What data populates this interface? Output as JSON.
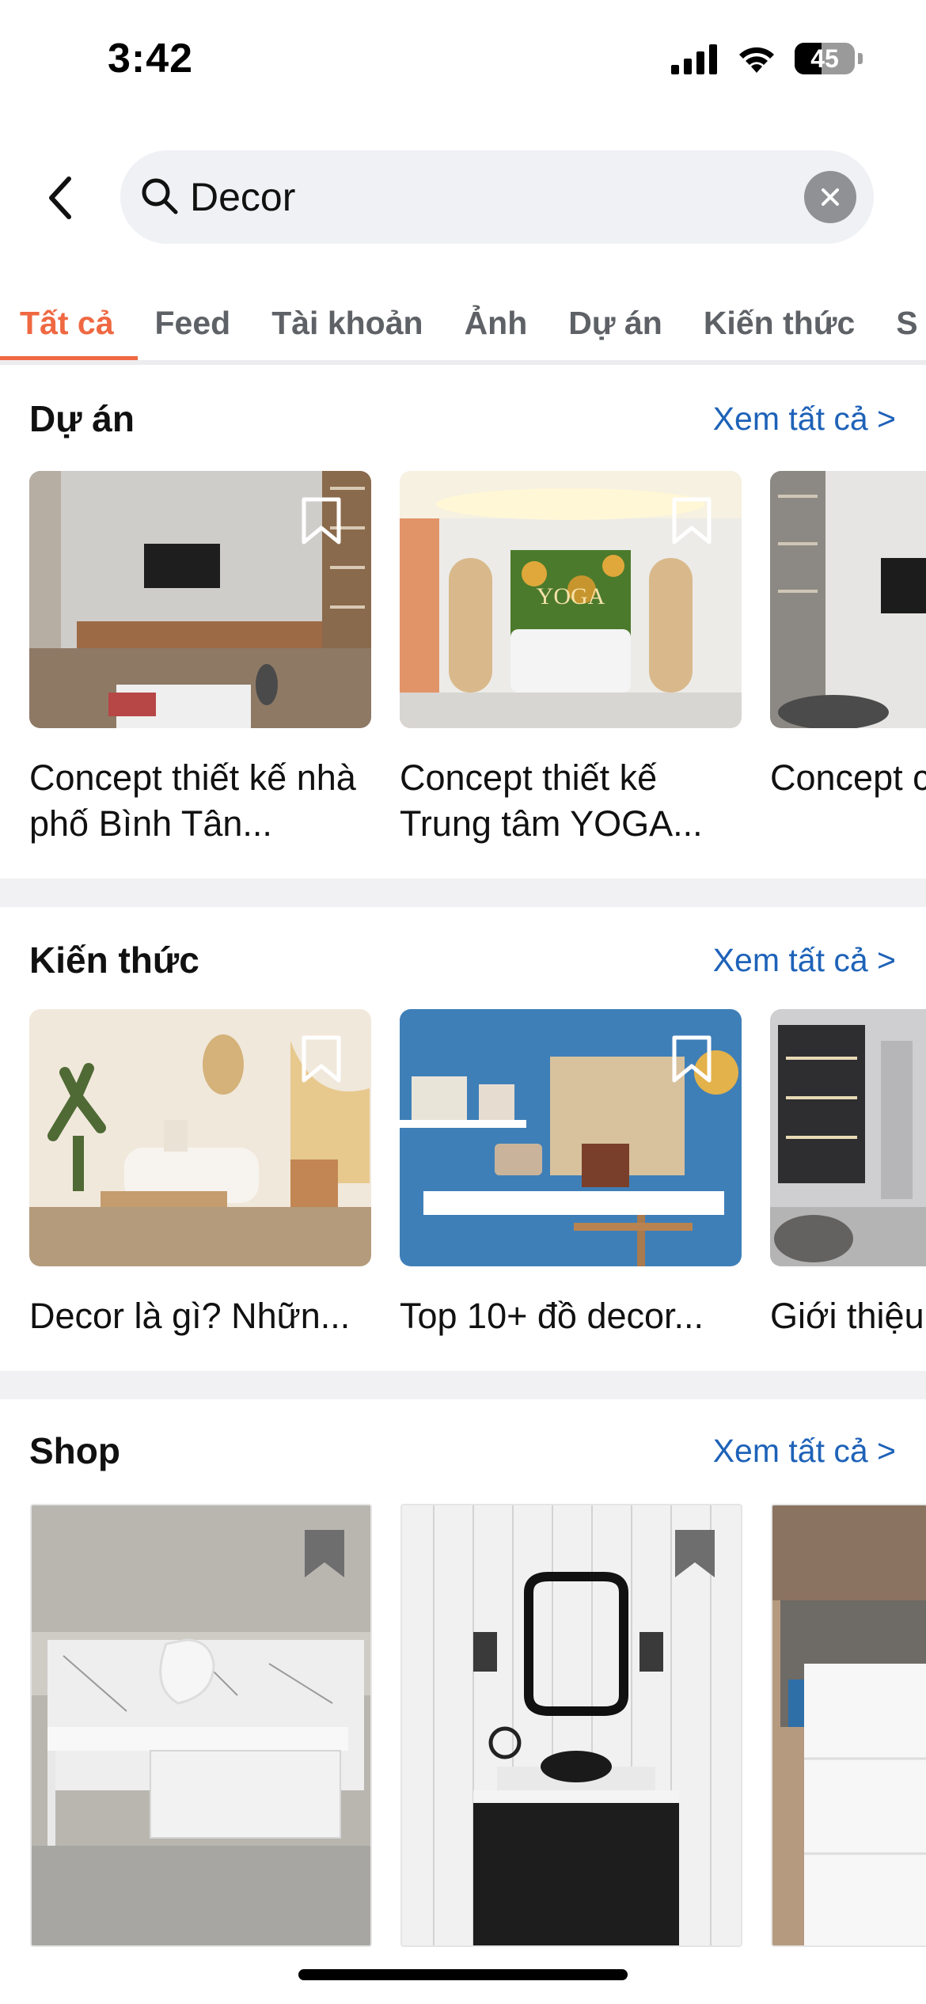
{
  "status_bar": {
    "time": "3:42",
    "battery": "45",
    "battery_level": 0.45
  },
  "search": {
    "query": "Decor",
    "placeholder": ""
  },
  "tabs": [
    {
      "label": "Tất cả",
      "active": true
    },
    {
      "label": "Feed",
      "active": false
    },
    {
      "label": "Tài khoản",
      "active": false
    },
    {
      "label": "Ảnh",
      "active": false
    },
    {
      "label": "Dự án",
      "active": false
    },
    {
      "label": "Kiến thức",
      "active": false
    },
    {
      "label": "S",
      "active": false
    }
  ],
  "sections": {
    "projects": {
      "title": "Dự án",
      "see_all": "Xem tất cả >",
      "cards": [
        {
          "title": "Concept thiết kế nhà phố Bình Tân..."
        },
        {
          "title": "Concept thiết kế Trung tâm YOGA..."
        },
        {
          "title": "Concept căn hộ H"
        }
      ]
    },
    "knowledge": {
      "title": "Kiến thức",
      "see_all": "Xem tất cả >",
      "cards": [
        {
          "title": "Decor là gì? Nhữn..."
        },
        {
          "title": "Top 10+ đồ decor..."
        },
        {
          "title": "Giới thiệu"
        }
      ]
    },
    "shop": {
      "title": "Shop",
      "see_all": "Xem tất cả >"
    }
  },
  "image_text": {
    "yoga_sign": "YOGA"
  },
  "colors": {
    "accent": "#ef6842",
    "link": "#1e62b8",
    "tab_inactive": "#5e6166"
  }
}
